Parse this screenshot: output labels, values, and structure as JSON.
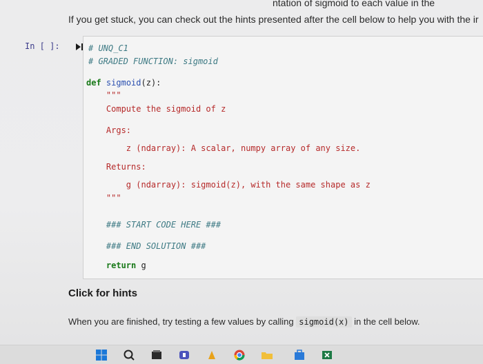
{
  "intro_text": "If you get stuck, you can check out the hints presented after the cell below to help you with the ir",
  "top_cut_text": "ntation of sigmoid to each value in the",
  "cell": {
    "prompt": "In [ ]:",
    "lines": [
      "# UNQ_C1",
      "# GRADED FUNCTION: sigmoid",
      "",
      "def sigmoid(z):",
      "    \"\"\"",
      "    Compute the sigmoid of z",
      "",
      "    Args:",
      "        z (ndarray): A scalar, numpy array of any size.",
      "",
      "    Returns:",
      "        g (ndarray): sigmoid(z), with the same shape as z",
      "",
      "    \"\"\"",
      "",
      "    ### START CODE HERE ###",
      "",
      "    ### END SOLUTION ###",
      "",
      "    return g"
    ]
  },
  "hints_label": "Click for hints",
  "bottom_text_before": "When you are finished, try testing a few values by calling",
  "bottom_code": "sigmoid(x)",
  "bottom_text_after": "in the cell below.",
  "taskbar_icons": [
    "windows-start-icon",
    "search-icon",
    "file-explorer-icon",
    "teams-icon",
    "app-icon",
    "chrome-icon",
    "folder-icon",
    "store-icon",
    "excel-icon"
  ]
}
